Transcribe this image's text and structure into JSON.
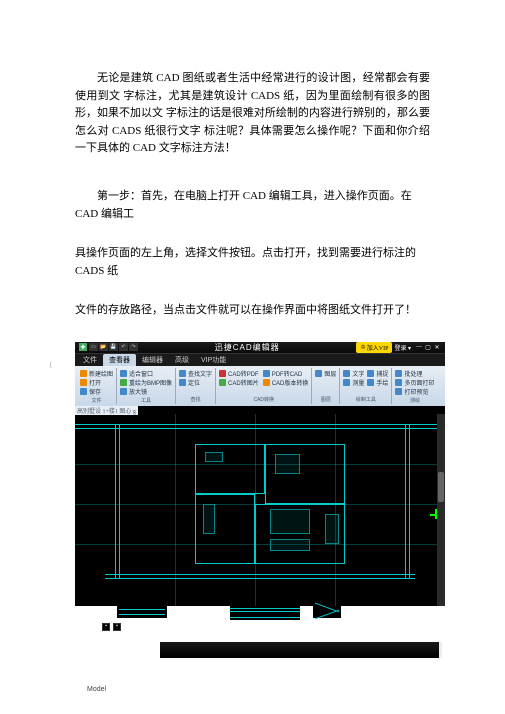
{
  "intro": "无论是建筑 CAD 图纸或者生活中经常进行的设计图，经常都会有要使用到文 字标注，尤其是建筑设计 CADS 纸，因为里面绘制有很多的图形，如果不加以文 字标注的话是很难对所绘制的内容进行辨别的，那么要怎么对 CADS 纸很行文字 标注呢？具体需要怎么操作呢？下面和你介绍一下具体的  CAD 文字标注方法！",
  "step1_a": "第一步：首先，在电脑上打开 CAD 编辑工具，进入操作页面。在 CAD 编辑工",
  "step1_b": "具操作页面的左上角，选择文件按钮。点击打开，找到需要进行标注的 CADS 纸",
  "step1_c": "文件的存放路径，当点击文件就可以在操作界面中将图纸文件打开了！",
  "app": {
    "title": "迅捷CAD编辑器",
    "vip_label": "加入VIP",
    "login_label": "登录",
    "tabs": [
      "文件",
      "查看器",
      "编辑器",
      "高级",
      "VIP功能"
    ],
    "groups": {
      "open": {
        "items": [
          "新建绘图",
          "打开",
          "保存"
        ],
        "label": "文件"
      },
      "view": {
        "items": [
          "适合窗口",
          "重绘为BMP图像",
          "放大镜"
        ],
        "label": "工具"
      },
      "find": {
        "items": [
          "查找文字",
          "定位"
        ],
        "label": "查找"
      },
      "convert": {
        "items": [
          "CAD转PDF",
          "CAD转图片",
          "PDF转CAD",
          "CAD版本转换"
        ],
        "label": "CAD转换"
      },
      "layer": {
        "items": [
          "图层"
        ],
        "label": "图层"
      },
      "annot": {
        "items": [
          "文字",
          "测量",
          "捕捉",
          "手绘"
        ],
        "label": "绘制工具"
      },
      "batch": {
        "items": [
          "批处理",
          "多页面打印",
          "打印预览"
        ],
        "label": "测绘"
      }
    },
    "caption": "高别墅设 1+楼1 图心 g",
    "model_tab": "Model"
  },
  "side_marker": "（"
}
